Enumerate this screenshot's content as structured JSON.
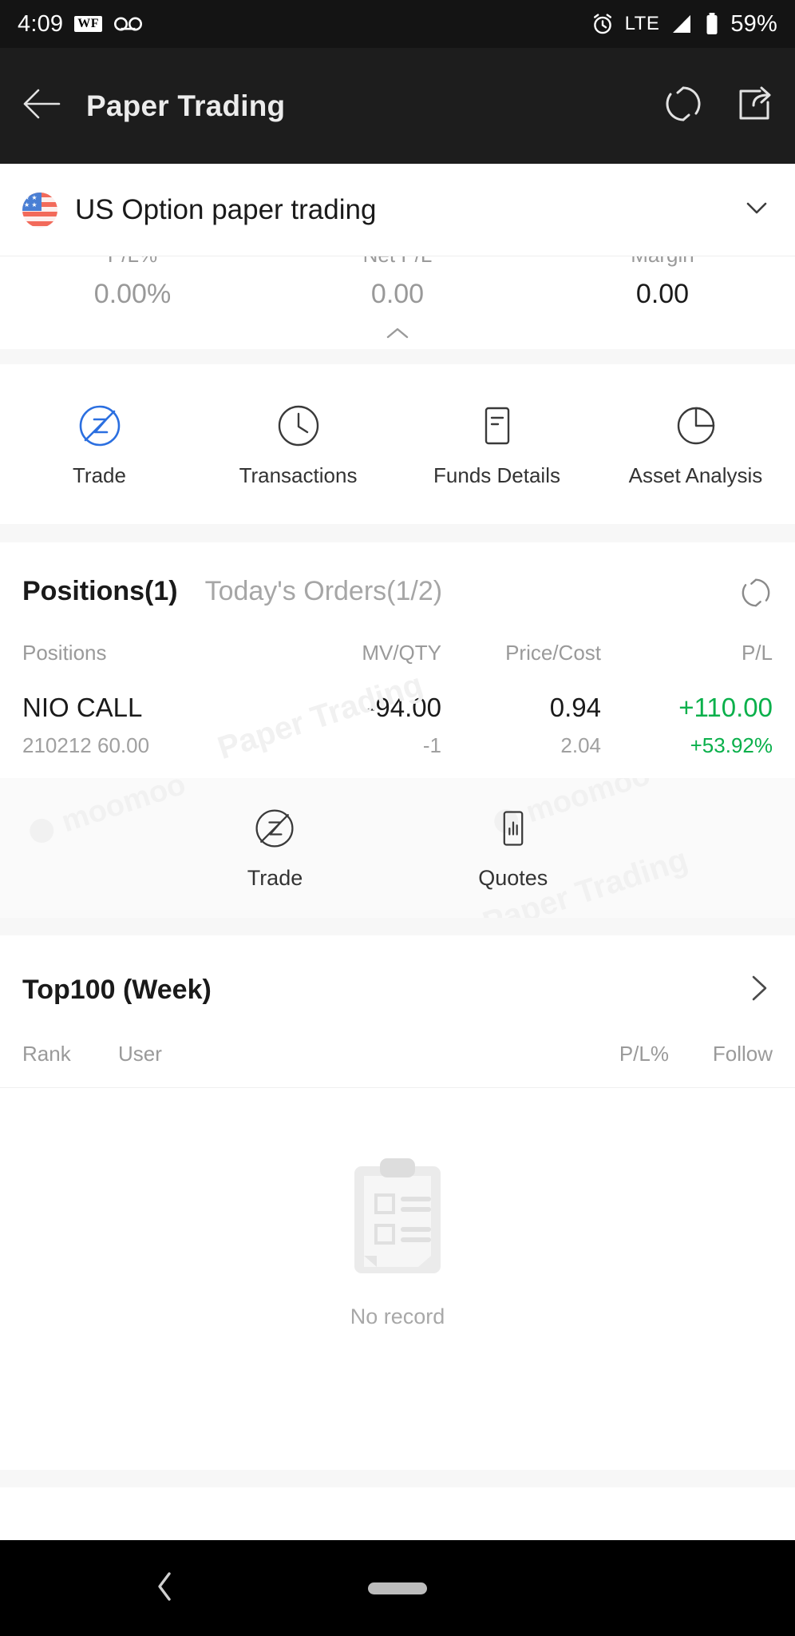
{
  "status_bar": {
    "time": "4:09",
    "wf_badge": "WF",
    "voicemail_icon": "voicemail-icon",
    "alarm_icon": "alarm-icon",
    "network": "LTE",
    "signal_icon": "signal-bars-icon",
    "battery_icon": "battery-icon",
    "battery_percent": "59%"
  },
  "header": {
    "back_icon": "back-arrow-icon",
    "title": "Paper Trading",
    "refresh_icon": "refresh-icon",
    "share_icon": "share-icon"
  },
  "account": {
    "flag_icon": "us-flag-icon",
    "name": "US Option paper trading",
    "chevron_icon": "chevron-down-icon"
  },
  "stats": {
    "collapse_icon": "chevron-up-icon",
    "items": [
      {
        "label": "P/L%",
        "value": "0.00%",
        "emphasis": "muted"
      },
      {
        "label": "Net P/L",
        "value": "0.00",
        "emphasis": "muted"
      },
      {
        "label": "Margin",
        "value": "0.00",
        "emphasis": "dark"
      }
    ]
  },
  "quick_actions": [
    {
      "label": "Trade",
      "icon": "trade-z-icon",
      "active": true
    },
    {
      "label": "Transactions",
      "icon": "clock-icon",
      "active": false
    },
    {
      "label": "Funds Details",
      "icon": "document-icon",
      "active": false
    },
    {
      "label": "Asset Analysis",
      "icon": "pie-chart-icon",
      "active": false
    }
  ],
  "positions": {
    "tab_active": "Positions(1)",
    "tab_idle": "Today's Orders(1/2)",
    "refresh_icon": "refresh-icon",
    "columns": [
      "Positions",
      "MV/QTY",
      "Price/Cost",
      "P/L"
    ],
    "rows": [
      {
        "name": "NIO CALL",
        "detail": "210212 60.00",
        "mv": "-94.00",
        "qty": "-1",
        "price": "0.94",
        "cost": "2.04",
        "pl": "+110.00",
        "pl_pct": "+53.92%",
        "pl_color": "#0ab04b"
      }
    ]
  },
  "position_actions": [
    {
      "label": "Trade",
      "icon": "trade-z-icon"
    },
    {
      "label": "Quotes",
      "icon": "quotes-bar-icon"
    }
  ],
  "top100": {
    "title": "Top100 (Week)",
    "chevron_icon": "chevron-right-icon",
    "columns": [
      "Rank",
      "User",
      "P/L%",
      "Follow"
    ],
    "empty_icon": "clipboard-empty-icon",
    "empty_text": "No record"
  },
  "watermarks": {
    "paper_trading": "Paper Trading",
    "moomoo": "moomoo"
  },
  "nav": {
    "back_icon": "nav-back-icon",
    "home_pill_icon": "nav-home-pill-icon"
  },
  "colors": {
    "accent_blue": "#2b6fe0",
    "positive_green": "#0ab04b",
    "header_bg": "#1d1d1d",
    "muted_text": "#9a9a9a"
  }
}
